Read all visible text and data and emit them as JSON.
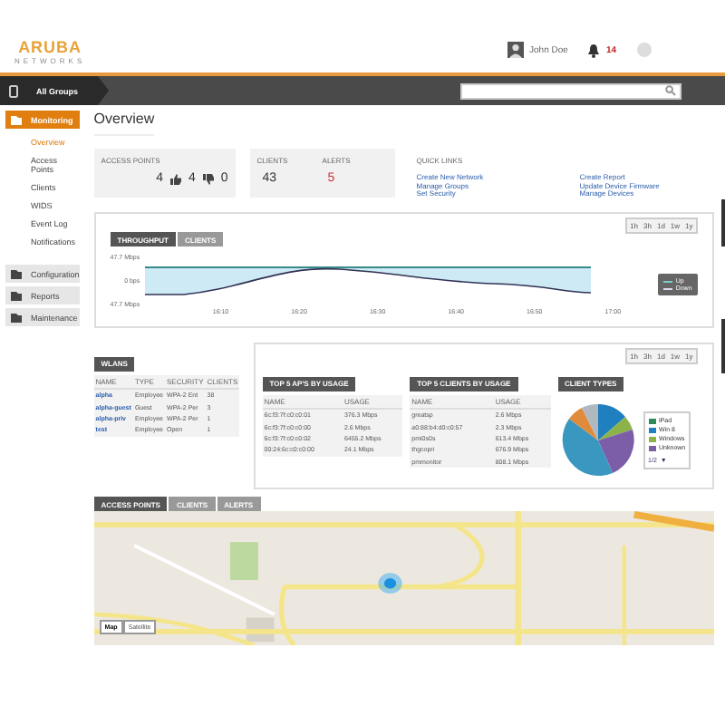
{
  "header": {
    "logo": "ARUBA",
    "logo_sub": "NETWORKS",
    "user": "John Doe",
    "alert_count": "14"
  },
  "toolbar": {
    "group": "All Groups"
  },
  "sidebar": {
    "items": [
      {
        "label": "Monitoring",
        "selected": true,
        "children": [
          {
            "label": "Overview",
            "selected": true
          },
          {
            "label": "Access Points",
            "selected": false
          },
          {
            "label": "Clients",
            "selected": false
          },
          {
            "label": "WIDS",
            "selected": false
          },
          {
            "label": "Event Log",
            "selected": false
          },
          {
            "label": "Notifications",
            "selected": false
          }
        ]
      },
      {
        "label": "Configuration",
        "selected": false
      },
      {
        "label": "Reports",
        "selected": false
      },
      {
        "label": "Maintenance",
        "selected": false
      }
    ]
  },
  "page_title": "Overview",
  "summary": {
    "access_points": {
      "label": "ACCESS POINTS",
      "total": "4",
      "up": "4",
      "down": "0"
    },
    "clients": {
      "label": "CLIENTS",
      "value": "43"
    },
    "alerts": {
      "label": "ALERTS",
      "value": "5"
    }
  },
  "quick_links": {
    "title": "QUICK LINKS",
    "links": [
      "Create New Network",
      "Manage Groups",
      "Set Security",
      "Create Report",
      "Update Device Firmware",
      "Manage Devices"
    ]
  },
  "throughput": {
    "ranges": [
      "1h",
      "3h",
      "1d",
      "1w",
      "1y"
    ],
    "tabs": [
      {
        "label": "THROUGHPUT",
        "selected": true
      },
      {
        "label": "CLIENTS",
        "selected": false
      }
    ],
    "y_labels": [
      "47.7 Mbps",
      "0 bps",
      "47.7 Mbps"
    ],
    "x_labels": [
      "16:10",
      "16:20",
      "16:30",
      "16:40",
      "16:50",
      "17:00"
    ],
    "legend": [
      "Up",
      "Down"
    ]
  },
  "wlans": {
    "title": "WLANS",
    "columns": [
      "NAME",
      "TYPE",
      "SECURITY",
      "CLIENTS"
    ],
    "rows": [
      [
        "alpha",
        "Employee",
        "WPA-2 Ent",
        "38"
      ],
      [
        "alpha-guest",
        "Guest",
        "WPA-2 Per",
        "3"
      ],
      [
        "alpha-priv",
        "Employee",
        "WPA-2 Per",
        "1"
      ],
      [
        "test",
        "Employee",
        "Open",
        "1"
      ]
    ]
  },
  "usage": {
    "ranges": [
      "1h",
      "3h",
      "1d",
      "1w",
      "1y"
    ],
    "top_aps": {
      "title": "TOP 5 AP'S BY USAGE",
      "columns": [
        "NAME",
        "USAGE"
      ],
      "rows": [
        [
          "6c:f3:7f:c0:c0:01",
          "376.3 Mbps"
        ],
        [
          "6c:f3:7f:c0:c0:00",
          "2.6 Mbps"
        ],
        [
          "6c:f3:7f:c0:c0:02",
          "6455.2 Mbps"
        ],
        [
          "00:24:6c:c0:c0:00",
          "24.1 Mbps"
        ]
      ]
    },
    "top_clients": {
      "title": "TOP 5 CLIENTS BY USAGE",
      "columns": [
        "NAME",
        "USAGE"
      ],
      "rows": [
        [
          "greatsp",
          "2.6 Mbps"
        ],
        [
          "a0:88:b4:d0:c0:57",
          "2.3 Mbps"
        ],
        [
          "pmi0s0s",
          "613.4 Mbps"
        ],
        [
          "thgcopri",
          "676.9 Mbps"
        ],
        [
          "pmmonitor",
          "808.1 Mbps"
        ]
      ]
    },
    "client_types": {
      "title": "CLIENT TYPES",
      "legend": [
        {
          "label": "iPad",
          "color": "#2e8b57"
        },
        {
          "label": "Win 8",
          "color": "#1f7fbf"
        },
        {
          "label": "Windows",
          "color": "#8bb34a"
        },
        {
          "label": "Unknown",
          "color": "#7b5ea7"
        }
      ],
      "pager": "1/2",
      "pager_arrow": "▼"
    }
  },
  "map": {
    "tabs": [
      {
        "label": "ACCESS POINTS",
        "selected": true
      },
      {
        "label": "CLIENTS",
        "selected": false
      },
      {
        "label": "ALERTS",
        "selected": false
      }
    ],
    "types": [
      {
        "label": "Map",
        "selected": true
      },
      {
        "label": "Satellite",
        "selected": false
      }
    ]
  }
}
